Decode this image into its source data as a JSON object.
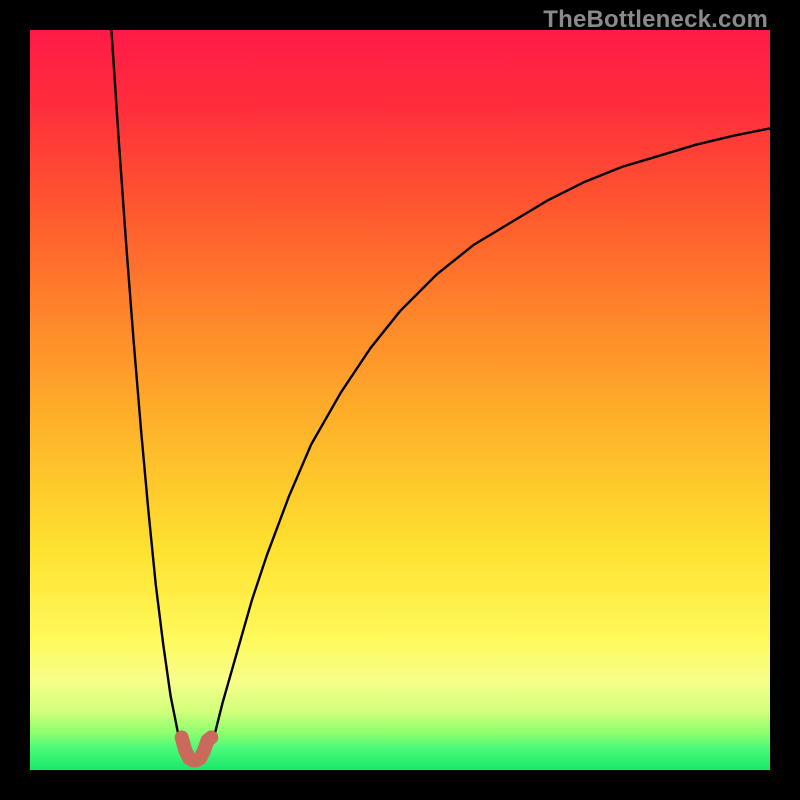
{
  "watermark": "TheBottleneck.com",
  "chart_data": {
    "type": "line",
    "title": "",
    "xlabel": "",
    "ylabel": "",
    "xlim": [
      0,
      100
    ],
    "ylim": [
      0,
      100
    ],
    "grid": false,
    "note": "Bottleneck-percentage style chart. Gradient background from red (high bottleneck) at top through orange/yellow to green (optimal) at bottom. Black V-shaped curve with sharp minimum indicating the balance point between two components; minimum near x≈22. A short salmon 'u' marker sits at the curve's dip.",
    "series": [
      {
        "name": "left-branch",
        "x": [
          11,
          12,
          13,
          14,
          15,
          16,
          17,
          18,
          19,
          20,
          21
        ],
        "y": [
          100,
          85,
          71,
          58,
          46,
          35,
          25,
          17,
          10,
          5,
          2
        ]
      },
      {
        "name": "right-branch",
        "x": [
          24,
          25,
          26,
          28,
          30,
          32,
          35,
          38,
          42,
          46,
          50,
          55,
          60,
          65,
          70,
          75,
          80,
          85,
          90,
          95,
          100
        ],
        "y": [
          2,
          5,
          9,
          16,
          23,
          29,
          37,
          44,
          51,
          57,
          62,
          67,
          71,
          74,
          77,
          79.5,
          81.5,
          83,
          84.5,
          85.7,
          86.7
        ]
      },
      {
        "name": "dip-marker",
        "color": "#c96a5c",
        "x": [
          20.5,
          21,
          21.5,
          22,
          22.5,
          23,
          23.5,
          24,
          24.5
        ],
        "y": [
          4.4,
          2.6,
          1.6,
          1.3,
          1.3,
          1.6,
          2.6,
          4.0,
          4.4
        ]
      }
    ],
    "gradient_stops": [
      {
        "pct": 0,
        "color": "#ff1a47"
      },
      {
        "pct": 10,
        "color": "#ff2d3c"
      },
      {
        "pct": 25,
        "color": "#ff5a2e"
      },
      {
        "pct": 40,
        "color": "#ff8a2a"
      },
      {
        "pct": 55,
        "color": "#ffb72a"
      },
      {
        "pct": 70,
        "color": "#ffe12f"
      },
      {
        "pct": 82,
        "color": "#fff95a"
      },
      {
        "pct": 88,
        "color": "#f7ff8a"
      },
      {
        "pct": 92,
        "color": "#d2ff7a"
      },
      {
        "pct": 95,
        "color": "#8cff6e"
      },
      {
        "pct": 97,
        "color": "#4dfa7a"
      },
      {
        "pct": 100,
        "color": "#17e86b"
      }
    ]
  }
}
